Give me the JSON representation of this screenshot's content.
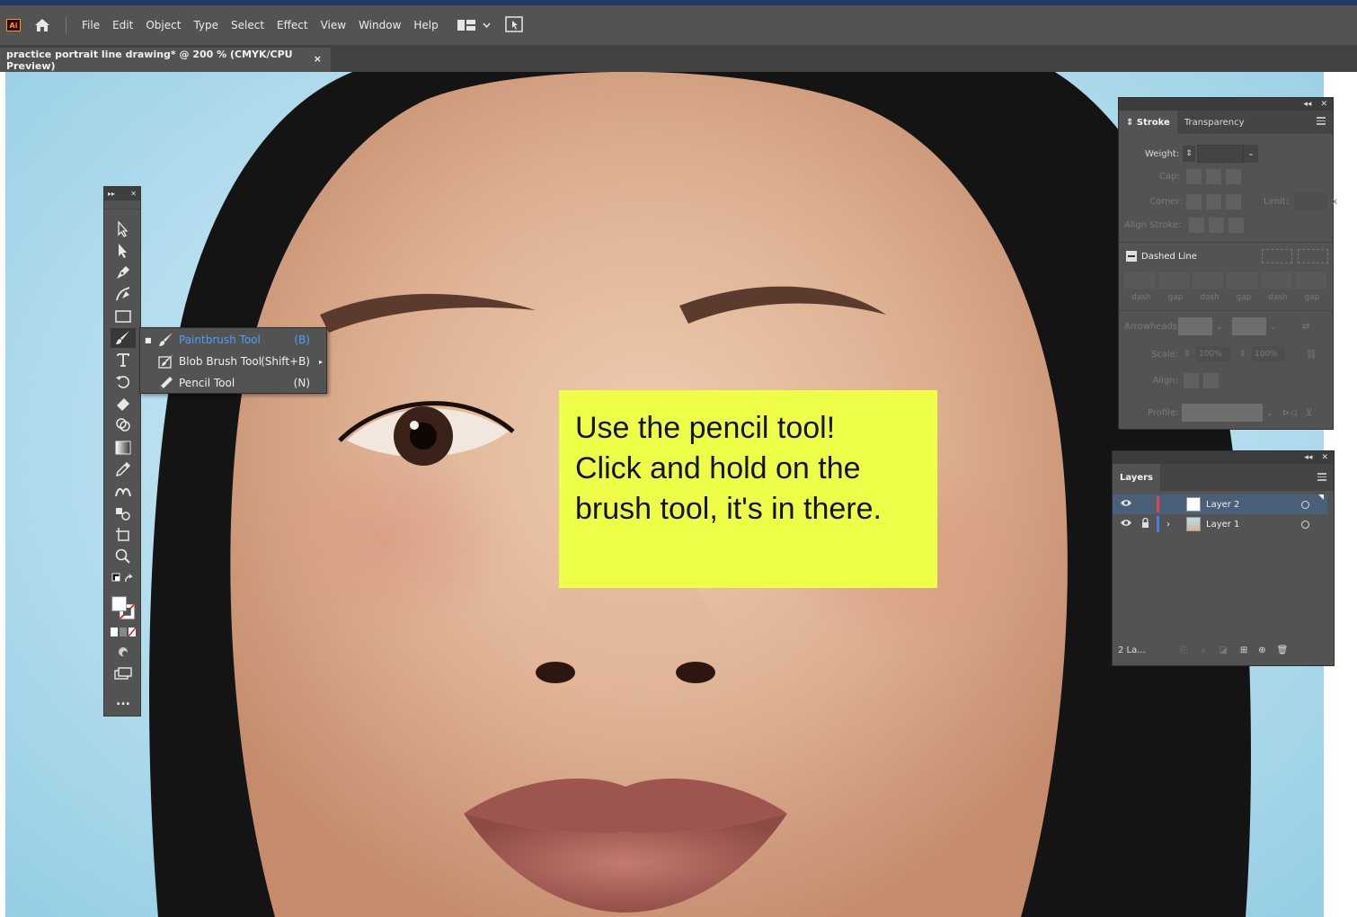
{
  "app": {
    "logo": "Ai",
    "menu": [
      "File",
      "Edit",
      "Object",
      "Type",
      "Select",
      "Effect",
      "View",
      "Window",
      "Help"
    ]
  },
  "document_tab": {
    "title": "practice portrait line drawing* @ 200 % (CMYK/CPU Preview)",
    "close": "×"
  },
  "toolbar": {
    "more": "..."
  },
  "flyout": {
    "items": [
      {
        "label": "Paintbrush Tool",
        "shortcut": "(B)"
      },
      {
        "label": "Blob Brush Tool",
        "shortcut": "(Shift+B)"
      },
      {
        "label": "Pencil Tool",
        "shortcut": "(N)"
      }
    ]
  },
  "note": {
    "lines": [
      "Use the pencil tool!",
      "Click and hold on the",
      "brush tool, it's in there."
    ]
  },
  "stroke_panel": {
    "tabs": [
      "Stroke",
      "Transparency"
    ],
    "weight_label": "Weight:",
    "cap_label": "Cap:",
    "corner_label": "Corner:",
    "limit_label": "Limit:",
    "limit_suffix": "x",
    "align_label": "Align Stroke:",
    "dashed_label": "Dashed Line",
    "dash_cols": [
      "dash",
      "gap",
      "dash",
      "gap",
      "dash",
      "gap"
    ],
    "arrowheads_label": "Arrowheads:",
    "scale_label": "Scale:",
    "scale_values": [
      "100%",
      "100%"
    ],
    "align2_label": "Align:",
    "profile_label": "Profile:"
  },
  "layers_panel": {
    "title": "Layers",
    "layers": [
      {
        "name": "Layer 2",
        "color": "#e8414a"
      },
      {
        "name": "Layer 1",
        "color": "#4a7de8"
      }
    ],
    "count": "2 La..."
  }
}
